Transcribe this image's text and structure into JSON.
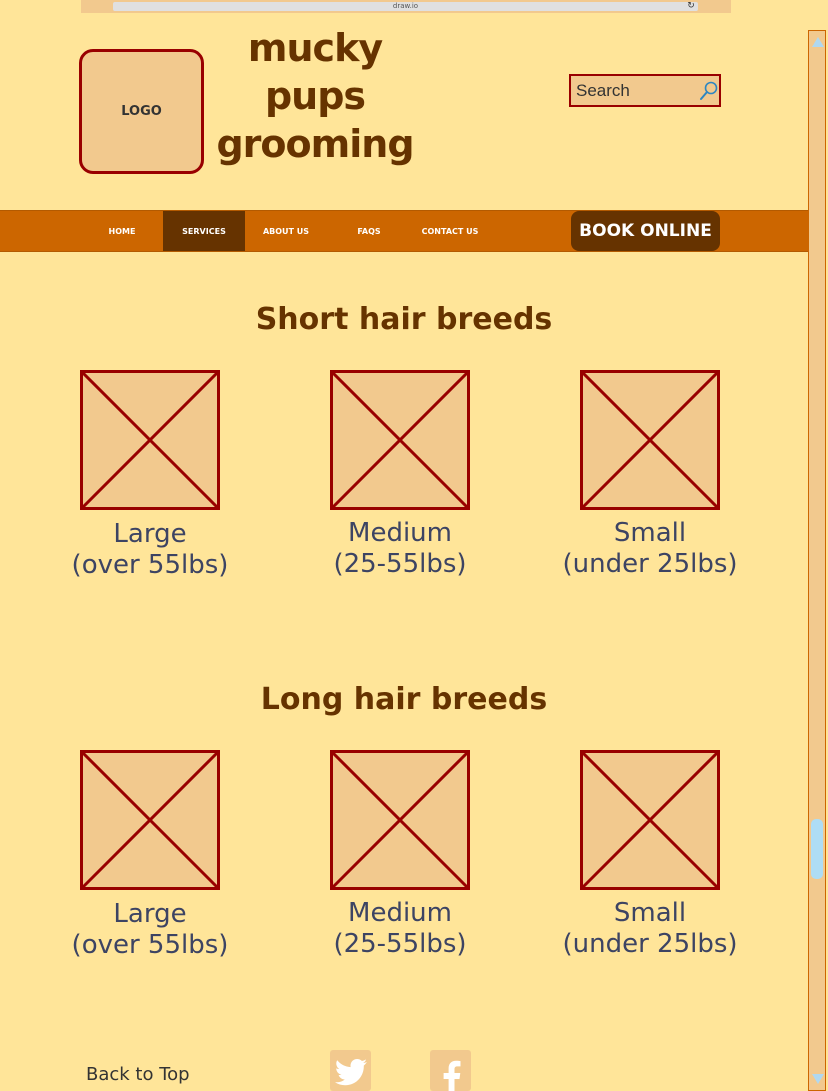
{
  "browser": {
    "url": "draw.io",
    "reload_icon": "reload-icon"
  },
  "header": {
    "logo_text": "LOGO",
    "brand_lines": [
      "mucky",
      "pups",
      "grooming"
    ],
    "search": {
      "placeholder": "Search",
      "icon": "search-icon"
    }
  },
  "nav": {
    "items": [
      {
        "label": "HOME",
        "active": false
      },
      {
        "label": "SERVICES",
        "active": true
      },
      {
        "label": "ABOUT US",
        "active": false
      },
      {
        "label": "FAQS",
        "active": false
      },
      {
        "label": "CONTACT US",
        "active": false
      }
    ],
    "book_label": "BOOK ONLINE"
  },
  "sections": [
    {
      "title": "Short hair breeds",
      "cards": [
        {
          "line1": "Large",
          "line2": "(over 55lbs)"
        },
        {
          "line1": "Medium",
          "line2": "(25-55lbs)"
        },
        {
          "line1": "Small",
          "line2": "(under 25lbs)"
        }
      ]
    },
    {
      "title": "Long hair breeds",
      "cards": [
        {
          "line1": "Large",
          "line2": "(over 55lbs)"
        },
        {
          "line1": "Medium",
          "line2": "(25-55lbs)"
        },
        {
          "line1": "Small",
          "line2": "(under 25lbs)"
        }
      ]
    }
  ],
  "footer": {
    "back_to_top": "Back to Top",
    "social": [
      "twitter-icon",
      "facebook-icon"
    ]
  },
  "colors": {
    "background": "#FFE599",
    "accent": "#CC6600",
    "dark_brown": "#663300",
    "placeholder_fill": "#F2C98E",
    "placeholder_stroke": "#990000",
    "label_text": "#3D4463"
  }
}
